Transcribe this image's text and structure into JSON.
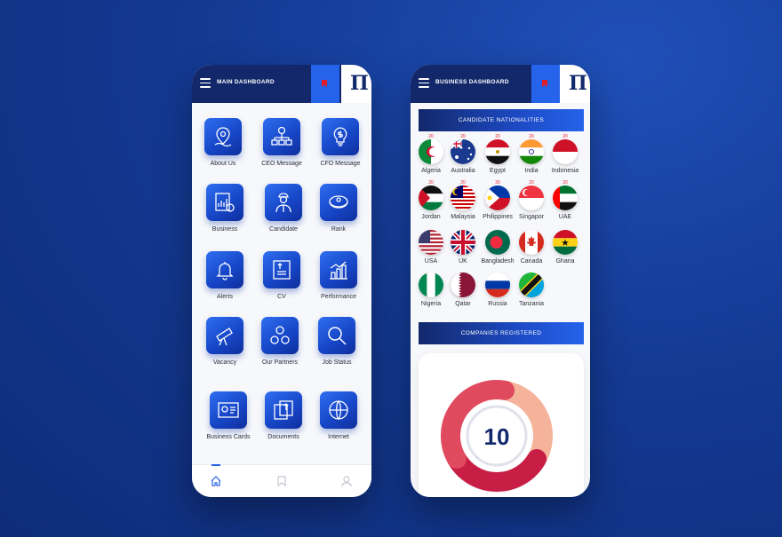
{
  "main_dashboard": {
    "title": "MAIN DASHBOARD",
    "items": [
      {
        "label": "About Us",
        "icon": "location-pin-icon"
      },
      {
        "label": "CEO Message",
        "icon": "org-chart-icon"
      },
      {
        "label": "CFO Message",
        "icon": "lightbulb-dollar-icon"
      },
      {
        "label": "Business",
        "icon": "business-chart-icon"
      },
      {
        "label": "Candidate",
        "icon": "candidate-icon"
      },
      {
        "label": "Rank",
        "icon": "rank-badge-icon"
      },
      {
        "label": "Alerts",
        "icon": "bell-icon"
      },
      {
        "label": "CV",
        "icon": "cv-document-icon"
      },
      {
        "label": "Performance",
        "icon": "performance-chart-icon"
      },
      {
        "label": "Vacancy",
        "icon": "telescope-icon"
      },
      {
        "label": "Our Partners",
        "icon": "partners-icon"
      },
      {
        "label": "Job Status",
        "icon": "magnifier-icon"
      },
      {
        "label": "Business Cards",
        "icon": "business-card-icon"
      },
      {
        "label": "Documents",
        "icon": "documents-icon"
      },
      {
        "label": "Internet",
        "icon": "www-globe-icon"
      }
    ],
    "bottom_nav": [
      "home-icon",
      "bookmark-icon",
      "user-icon"
    ]
  },
  "business_dashboard": {
    "title": "BUSINESS DASHBOARD",
    "nationalities_title": "CANDIDATE NATIONALITIES",
    "nationalities": [
      {
        "name": "Algeria",
        "count": "20"
      },
      {
        "name": "Australia",
        "count": "20"
      },
      {
        "name": "Egypt",
        "count": "20"
      },
      {
        "name": "India",
        "count": "20"
      },
      {
        "name": "Indonesia",
        "count": "20"
      },
      {
        "name": "Jordan",
        "count": "20"
      },
      {
        "name": "Malaysia",
        "count": "20"
      },
      {
        "name": "Philippines",
        "count": "20"
      },
      {
        "name": "Singapor",
        "count": "20"
      },
      {
        "name": "UAE",
        "count": "20"
      },
      {
        "name": "USA",
        "count": ""
      },
      {
        "name": "UK",
        "count": ""
      },
      {
        "name": "Bangladesh",
        "count": ""
      },
      {
        "name": "Canada",
        "count": ""
      },
      {
        "name": "Ghana",
        "count": ""
      },
      {
        "name": "Nigeria",
        "count": ""
      },
      {
        "name": "Qatar",
        "count": ""
      },
      {
        "name": "Russia",
        "count": ""
      },
      {
        "name": "Tanzania",
        "count": ""
      }
    ],
    "companies_title": "COMPANIES REGISTERED",
    "companies_count": "10"
  },
  "chart_data": {
    "type": "pie",
    "values": [
      10
    ],
    "title": "",
    "colors": [
      "#f4b39a",
      "#e04a5e",
      "#c81e45"
    ]
  },
  "colors": {
    "header": "#12286b",
    "accent": "#2563eb",
    "red": "#e11d2a"
  }
}
